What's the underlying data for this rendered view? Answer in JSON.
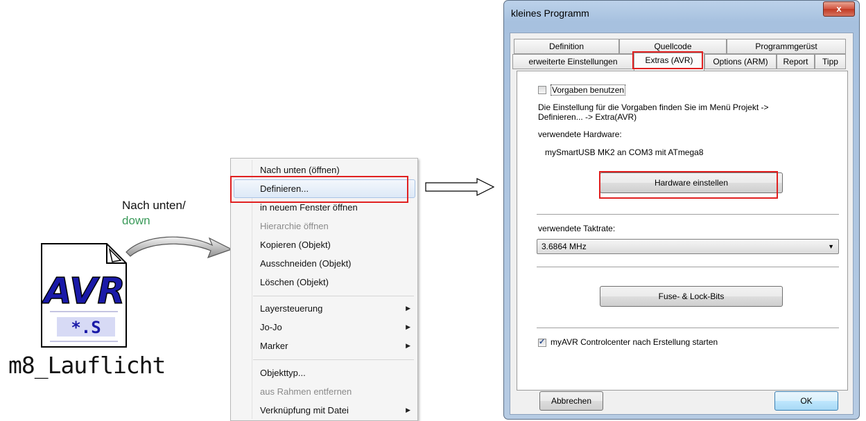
{
  "file": {
    "caption": "m8_Lauflicht",
    "badge": "AVR",
    "extension": "*.S"
  },
  "hint": {
    "line1": "Nach unten/",
    "line2": "down"
  },
  "menu": {
    "items": [
      {
        "label": "Nach unten (öffnen)",
        "state": "normal"
      },
      {
        "label": "Definieren...",
        "state": "hover"
      },
      {
        "label": "in neuem Fenster öffnen",
        "state": "normal"
      },
      {
        "label": "Hierarchie öffnen",
        "state": "disabled"
      },
      {
        "label": "Kopieren (Objekt)",
        "state": "normal"
      },
      {
        "label": "Ausschneiden (Objekt)",
        "state": "normal"
      },
      {
        "label": "Löschen (Objekt)",
        "state": "normal"
      },
      {
        "label": "Layersteuerung",
        "state": "submenu"
      },
      {
        "label": "Jo-Jo",
        "state": "submenu"
      },
      {
        "label": "Marker",
        "state": "submenu"
      },
      {
        "label": "Objekttyp...",
        "state": "normal"
      },
      {
        "label": "aus Rahmen entfernen",
        "state": "disabled"
      },
      {
        "label": "Verknüpfung mit Datei",
        "state": "submenu"
      }
    ],
    "submenu_glyph": "▶"
  },
  "dialog": {
    "title": "kleines Programm",
    "close_label": "x",
    "tabs_row1": [
      "Definition",
      "Quellcode",
      "Programmgerüst"
    ],
    "tabs_row2": [
      "erweiterte Einstellungen",
      "Extras (AVR)",
      "Options (ARM)",
      "Report",
      "Tipp"
    ],
    "active_tab": "Extras (AVR)",
    "use_defaults_label": "Vorgaben benutzen",
    "info_line1": "Die Einstellung für die Vorgaben finden Sie im Menü Projekt ->",
    "info_line2": "Definieren... -> Extra(AVR)",
    "hardware_label": "verwendete Hardware:",
    "hardware_value": "mySmartUSB MK2 an COM3 mit ATmega8",
    "hardware_button": "Hardware einstellen",
    "clock_label": "verwendete Taktrate:",
    "clock_value": "3.6864 MHz",
    "fuse_button": "Fuse- & Lock-Bits",
    "controlcenter_label": "myAVR Controlcenter nach Erstellung starten",
    "controlcenter_checked": true,
    "cancel_button": "Abbrechen",
    "ok_button": "OK"
  },
  "colors": {
    "highlight_red": "#e02020",
    "down_green": "#3b9a5a",
    "avr_blue": "#1a1aa8"
  }
}
